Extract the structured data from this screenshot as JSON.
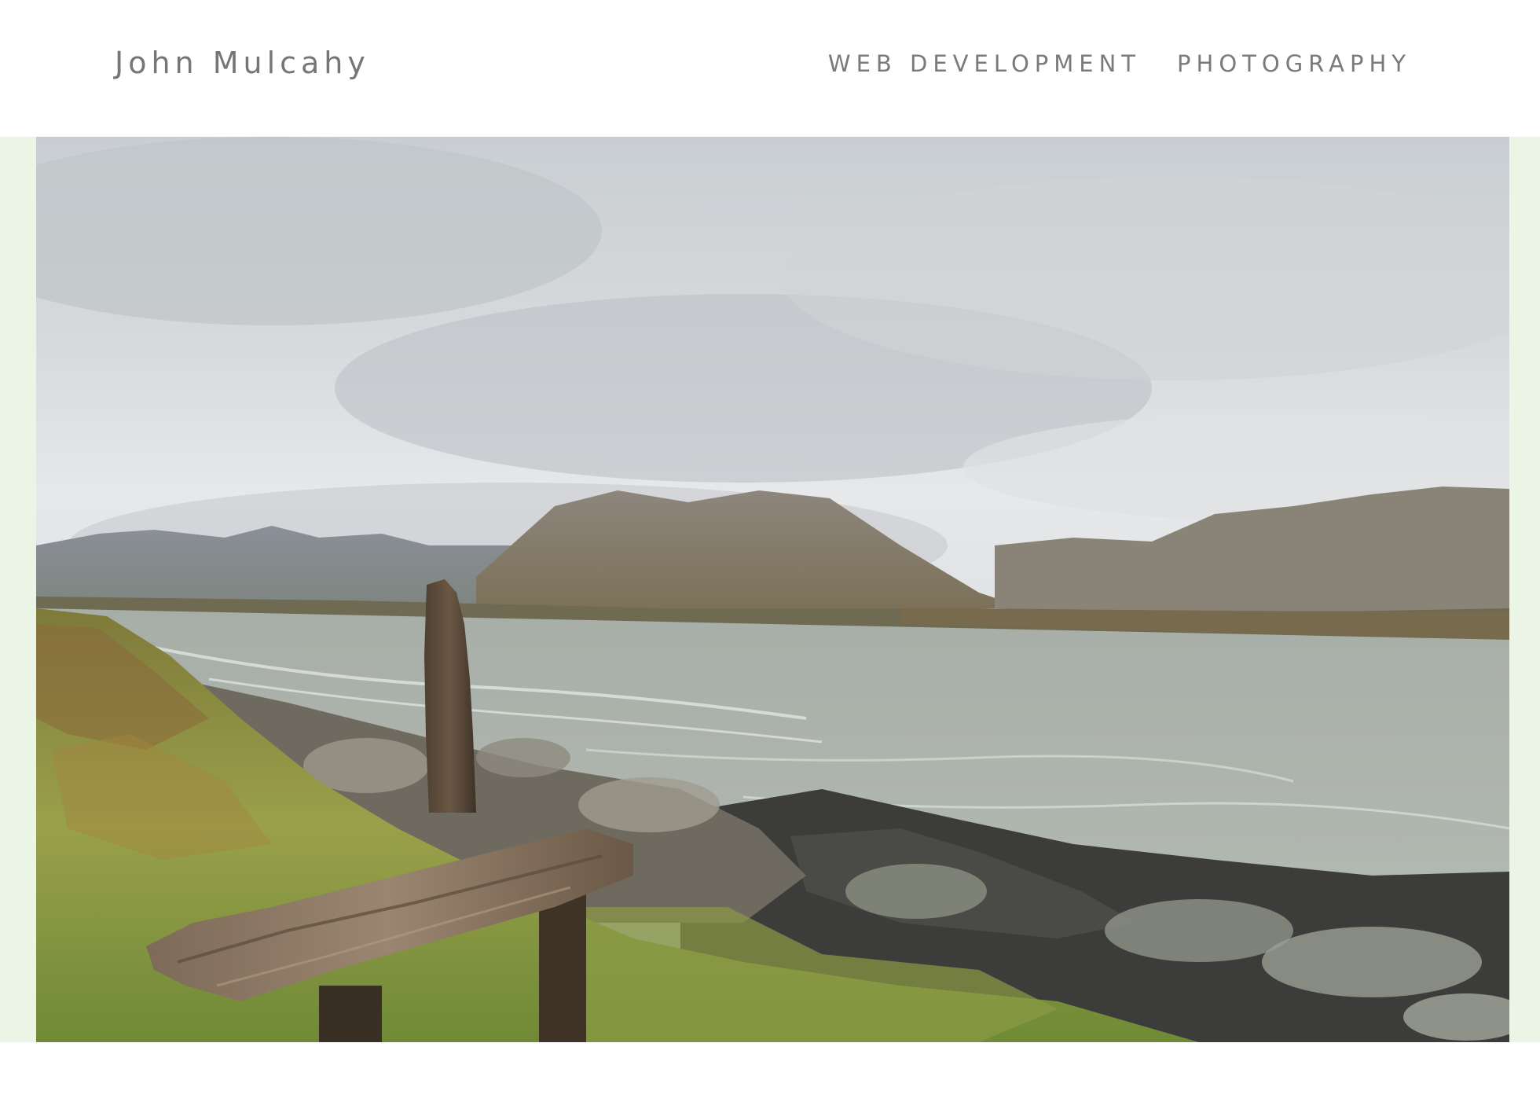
{
  "header": {
    "site_title": "John Mulcahy",
    "nav": [
      {
        "label": "WEB DEVELOPMENT"
      },
      {
        "label": "PHOTOGRAPHY"
      }
    ]
  },
  "hero": {
    "image_subject": "landscape-photo",
    "band_color": "#ebf5e6"
  }
}
